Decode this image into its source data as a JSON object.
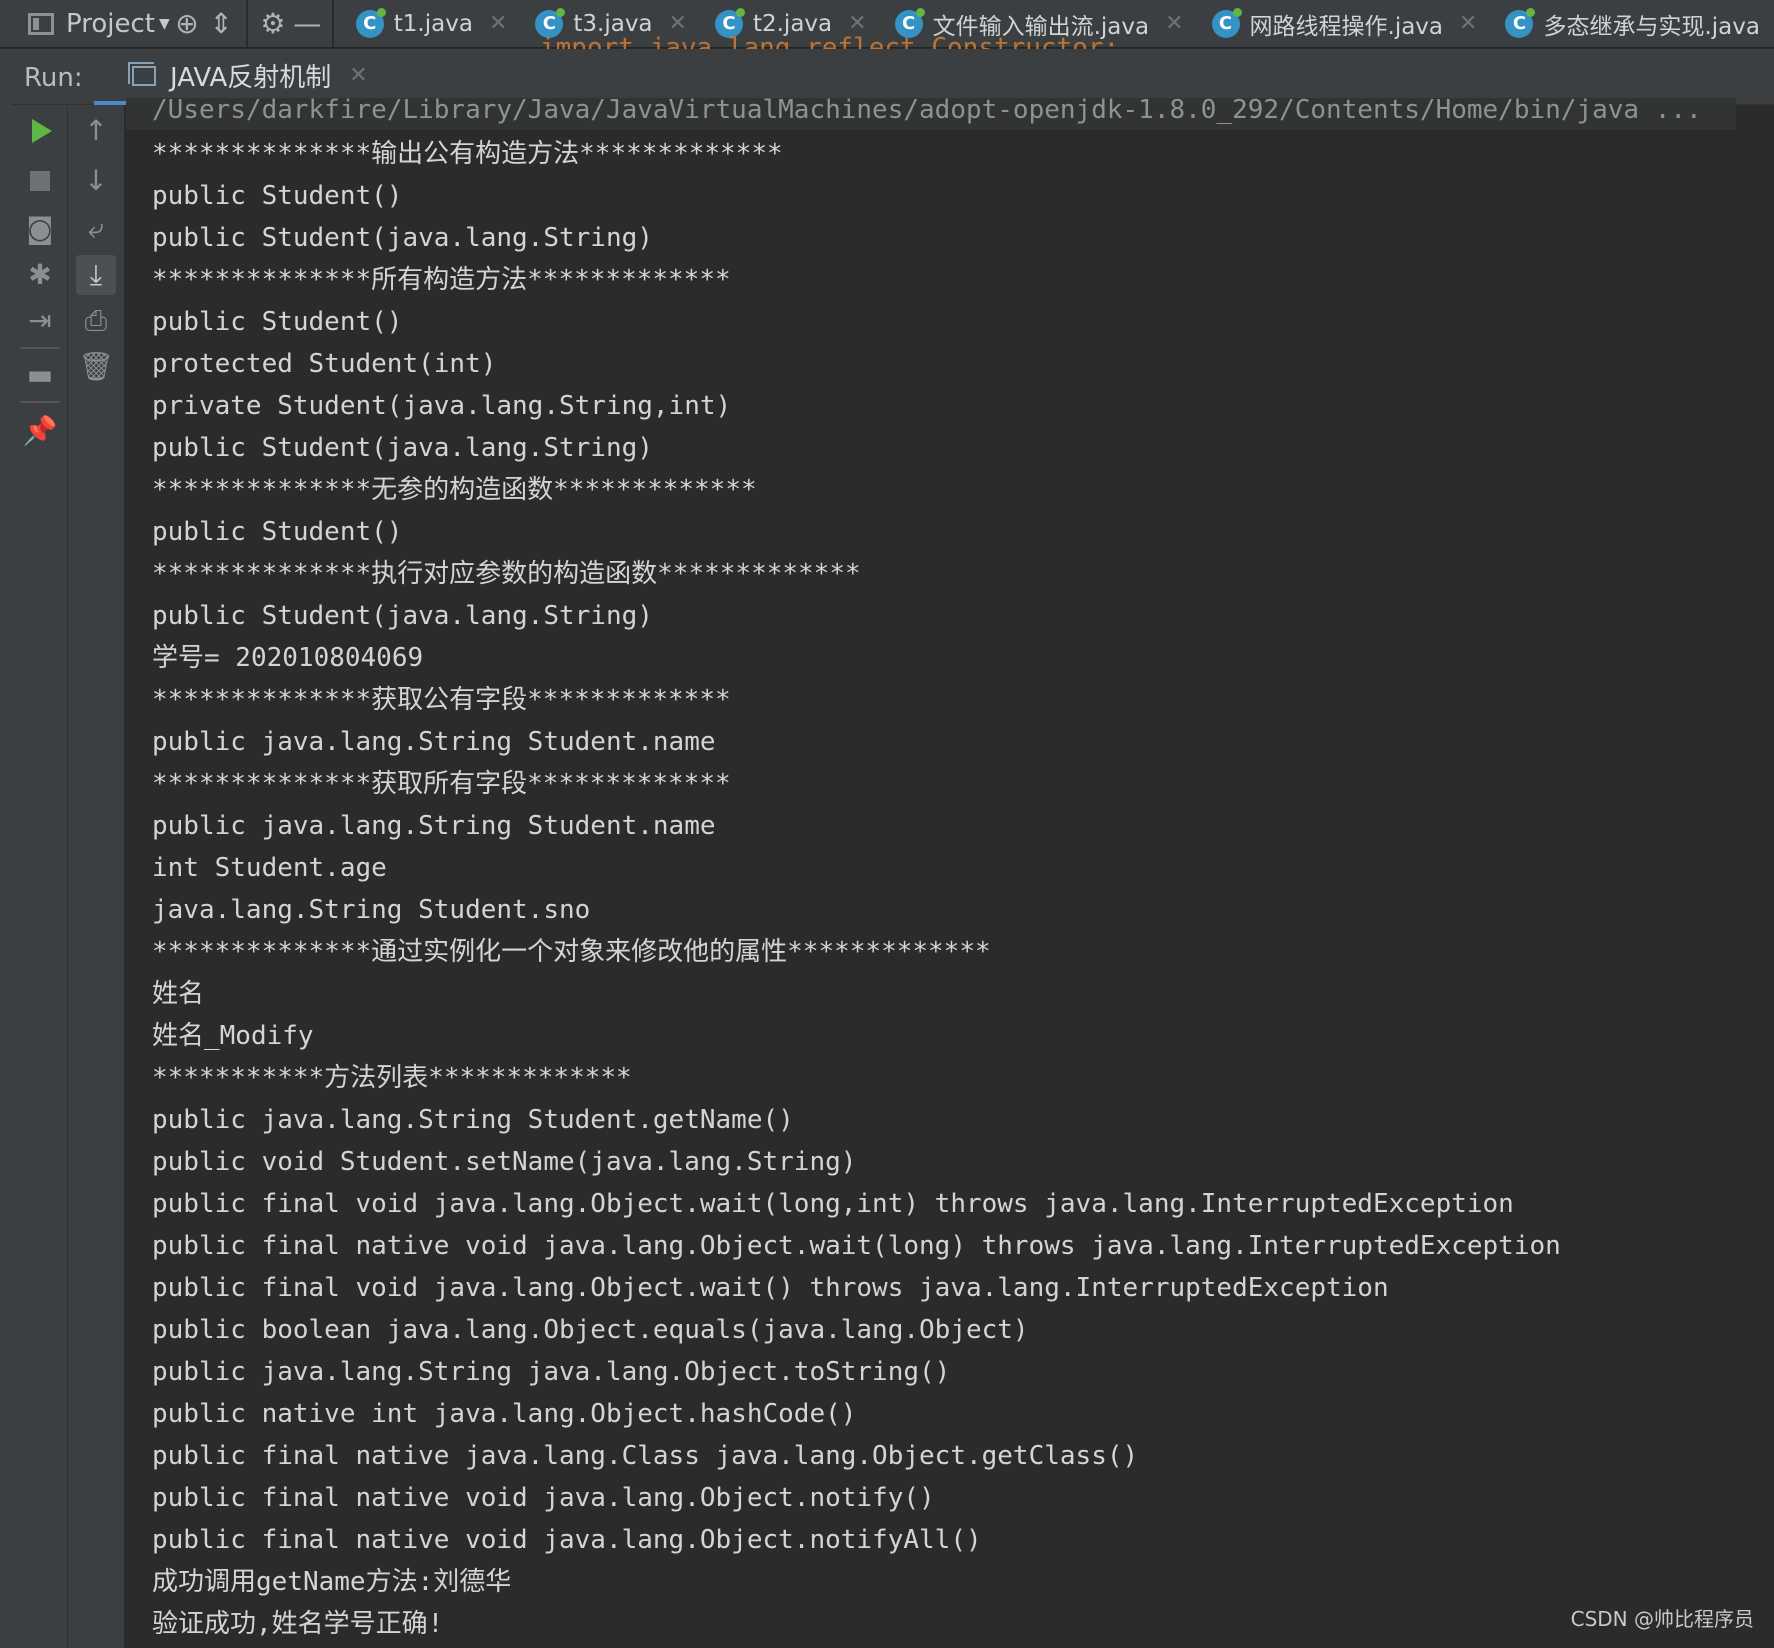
{
  "toolbar": {
    "project_label": "Project",
    "tabs": [
      {
        "name": "t1.java"
      },
      {
        "name": "t3.java"
      },
      {
        "name": "t2.java"
      },
      {
        "name": "文件输入输出流.java"
      },
      {
        "name": "网路线程操作.java"
      },
      {
        "name": "多态继承与实现.java"
      }
    ],
    "ghost_code": "import java.lang.reflect.Constructor;"
  },
  "run": {
    "label": "Run:",
    "tab_name": "JAVA反射机制"
  },
  "console": {
    "command": "/Users/darkfire/Library/Java/JavaVirtualMachines/adopt-openjdk-1.8.0_292/Contents/Home/bin/java ...",
    "lines": [
      "**************输出公有构造方法*************",
      "public Student()",
      "public Student(java.lang.String)",
      "**************所有构造方法*************",
      "public Student()",
      "protected Student(int)",
      "private Student(java.lang.String,int)",
      "public Student(java.lang.String)",
      "**************无参的构造函数*************",
      "public Student()",
      "**************执行对应参数的构造函数*************",
      "public Student(java.lang.String)",
      "学号= 202010804069",
      "**************获取公有字段*************",
      "public java.lang.String Student.name",
      "**************获取所有字段*************",
      "public java.lang.String Student.name",
      "int Student.age",
      "java.lang.String Student.sno",
      "**************通过实例化一个对象来修改他的属性*************",
      "姓名",
      "姓名_Modify",
      "***********方法列表*************",
      "public java.lang.String Student.getName()",
      "public void Student.setName(java.lang.String)",
      "public final void java.lang.Object.wait(long,int) throws java.lang.InterruptedException",
      "public final native void java.lang.Object.wait(long) throws java.lang.InterruptedException",
      "public final void java.lang.Object.wait() throws java.lang.InterruptedException",
      "public boolean java.lang.Object.equals(java.lang.Object)",
      "public java.lang.String java.lang.Object.toString()",
      "public native int java.lang.Object.hashCode()",
      "public final native java.lang.Class java.lang.Object.getClass()",
      "public final native void java.lang.Object.notify()",
      "public final native void java.lang.Object.notifyAll()",
      "成功调用getName方法:刘德华",
      "验证成功,姓名学号正确!"
    ]
  },
  "watermark": "CSDN @帅比程序员"
}
